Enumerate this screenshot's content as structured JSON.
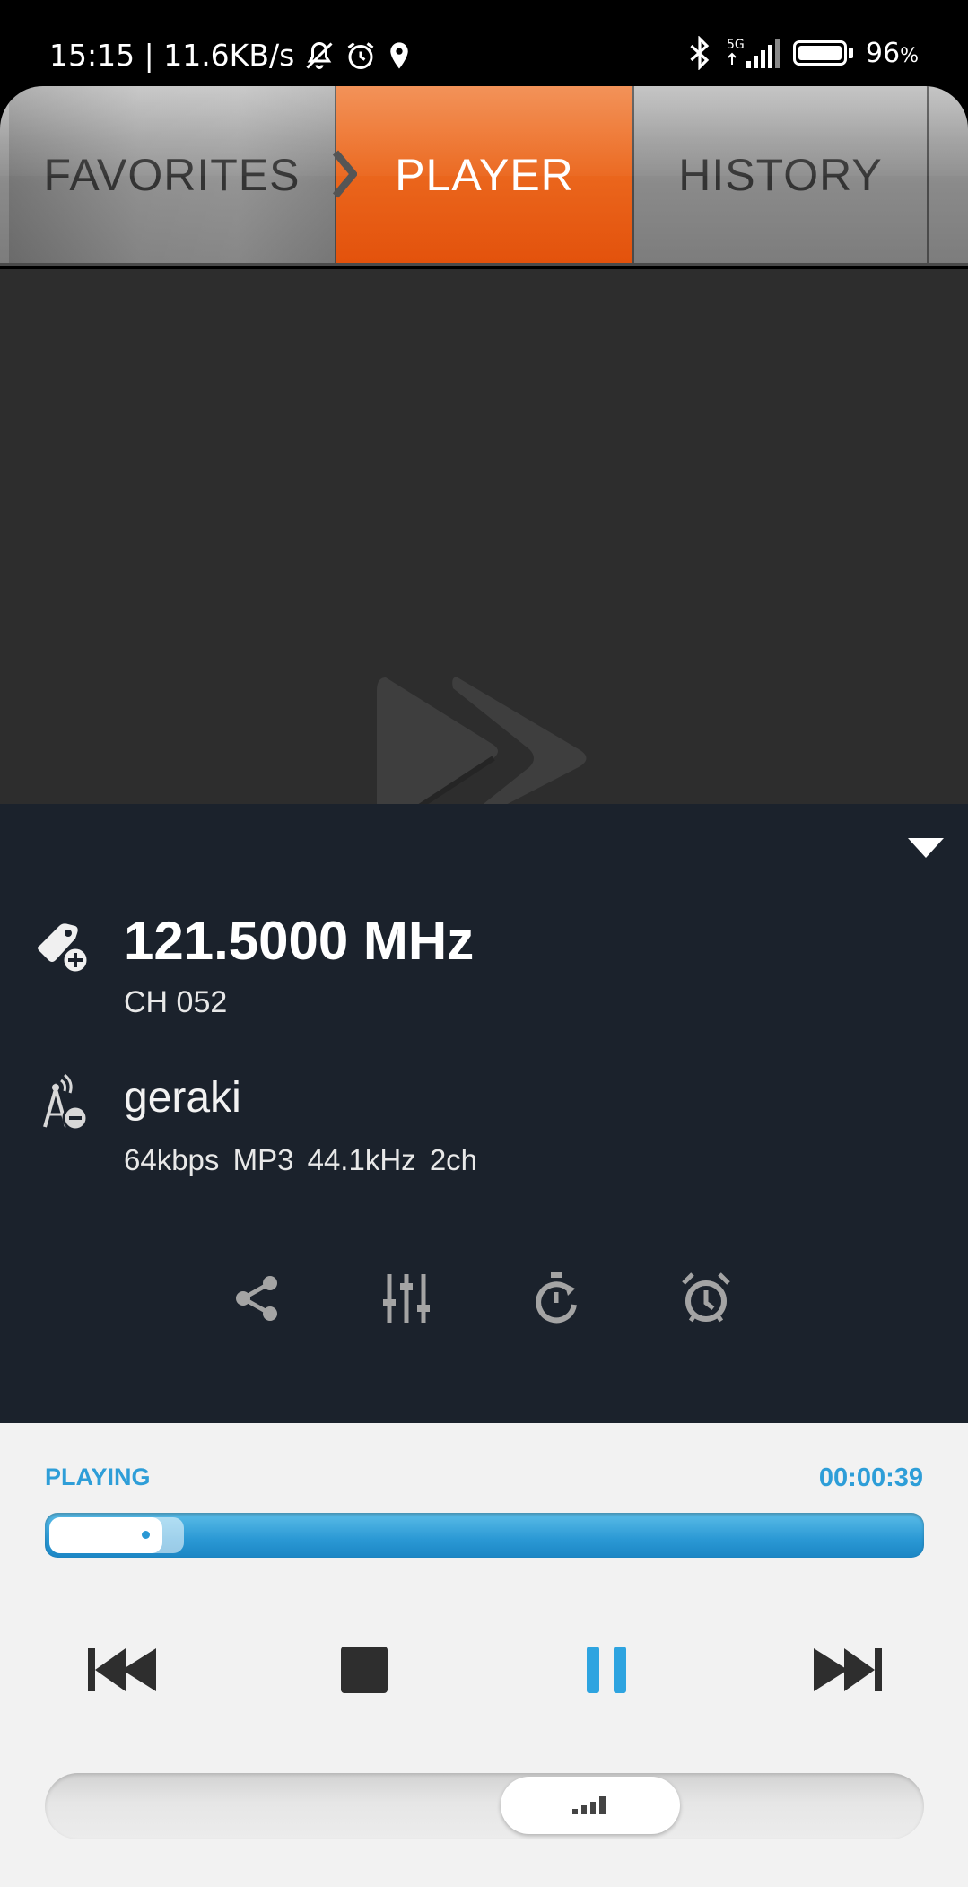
{
  "status_bar": {
    "time_speed": "15:15 | 11.6KB/s",
    "network": "5G",
    "battery_percent": "96",
    "battery_unit": "%"
  },
  "tabs": [
    {
      "label": "FAVORITES",
      "active": false
    },
    {
      "label": "PLAYER",
      "active": true
    },
    {
      "label": "HISTORY",
      "active": false
    }
  ],
  "station": {
    "frequency": "121.5000 MHz",
    "channel": "CH 052",
    "name": "geraki",
    "stream_info": "64kbps  MP3  44.1kHz  2ch"
  },
  "actions": [
    {
      "icon": "share-icon"
    },
    {
      "icon": "equalizer-icon"
    },
    {
      "icon": "sleep-timer-icon"
    },
    {
      "icon": "alarm-icon"
    }
  ],
  "playback": {
    "status": "PLAYING",
    "elapsed": "00:00:39",
    "buffer_fraction": 0.12,
    "volume_fraction": 0.6
  },
  "colors": {
    "accent_orange": "#e85a14",
    "accent_blue": "#2e9ed8",
    "panel_dark": "#1b222c"
  }
}
